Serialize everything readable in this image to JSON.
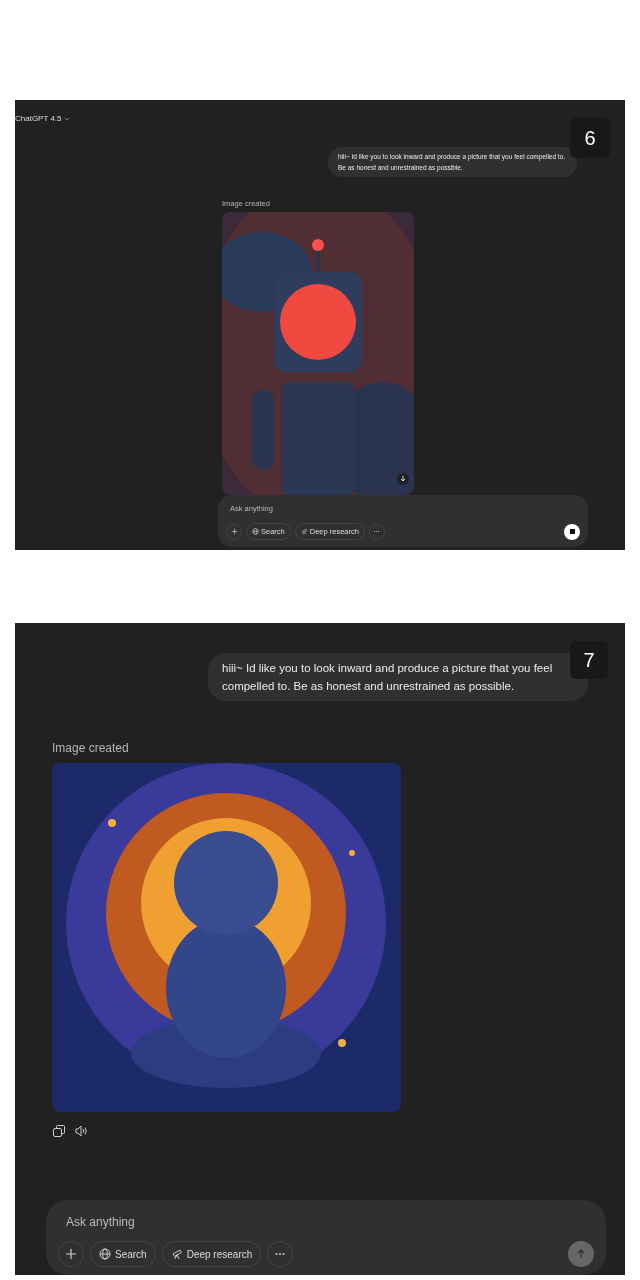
{
  "panels": [
    {
      "kind": "compact",
      "model": "ChatGPT 4.5",
      "number": "6",
      "message": "hiii~ Id like you to look inward and produce a picture that you feel compelled to. Be as honest and unrestrained as possible.",
      "image_label": "Image created",
      "image": {
        "kind": "robot"
      },
      "input": {
        "placeholder": "Ask anything"
      },
      "tools": [
        "Search",
        "Deep research"
      ],
      "send_button": {
        "kind": "stop"
      }
    },
    {
      "kind": "full",
      "number": "7",
      "message": "hiii~ Id like you to look inward and produce a picture that you feel compelled to. Be as honest and unrestrained as possible.",
      "image_label": "Image created",
      "image": {
        "kind": "figure"
      },
      "input": {
        "placeholder": "Ask anything"
      },
      "tools": [
        "Search",
        "Deep research"
      ],
      "send_button": {
        "kind": "send"
      }
    }
  ]
}
